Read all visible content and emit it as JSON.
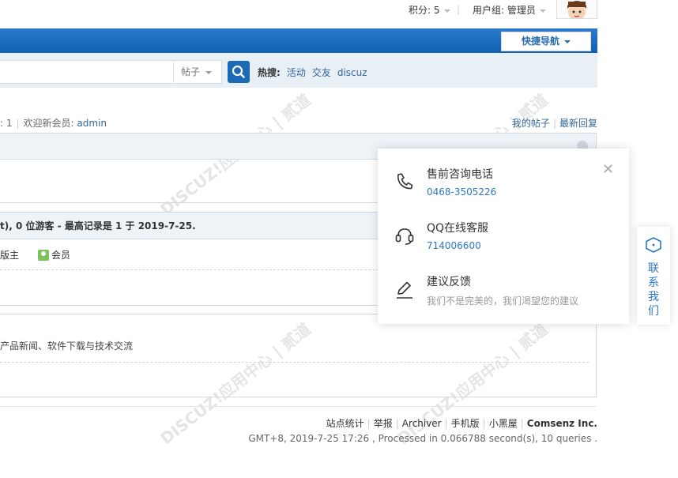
{
  "topbar": {
    "credits": "积分: 5",
    "usergroup": "用户组: 管理员"
  },
  "nav": {
    "quick_nav": "快捷导航"
  },
  "search": {
    "type_label": "帖子",
    "hot_label": "热搜:",
    "hot_items": [
      "活动",
      "交友",
      "discuz"
    ]
  },
  "info": {
    "members_prefix": ": 1",
    "welcome": "欢迎新会员:",
    "new_member": "admin",
    "my_posts": "我的帖子",
    "latest_reply": "最新回复"
  },
  "online": {
    "summary": "t), 0 位游客 - 最高记录是 1 于 2019-7-25.",
    "legend_moderator": "版主",
    "legend_member": "会员"
  },
  "forum": {
    "description": "产品新闻、软件下载与技术交流"
  },
  "footer": {
    "links": [
      "站点统计",
      "举报",
      "Archiver",
      "手机版",
      "小黑屋"
    ],
    "brand": "Comsenz Inc.",
    "meta": "GMT+8, 2019-7-25 17:26 , Processed in 0.066788 second(s), 10 queries ."
  },
  "contact_popup": {
    "items": [
      {
        "title": "售前咨询电话",
        "value": "0468-3505226",
        "icon": "phone-icon"
      },
      {
        "title": "QQ在线客服",
        "value": "714006600",
        "icon": "headset-icon"
      },
      {
        "title": "建议反馈",
        "value": "我们不是完美的，我们渴望您的建议",
        "icon": "pen-icon"
      }
    ]
  },
  "side_tab": {
    "label": "联系我们"
  },
  "colors": {
    "nav_blue": "#1b6ab7",
    "link_blue": "#336699",
    "popup_blue": "#2b78c5"
  }
}
